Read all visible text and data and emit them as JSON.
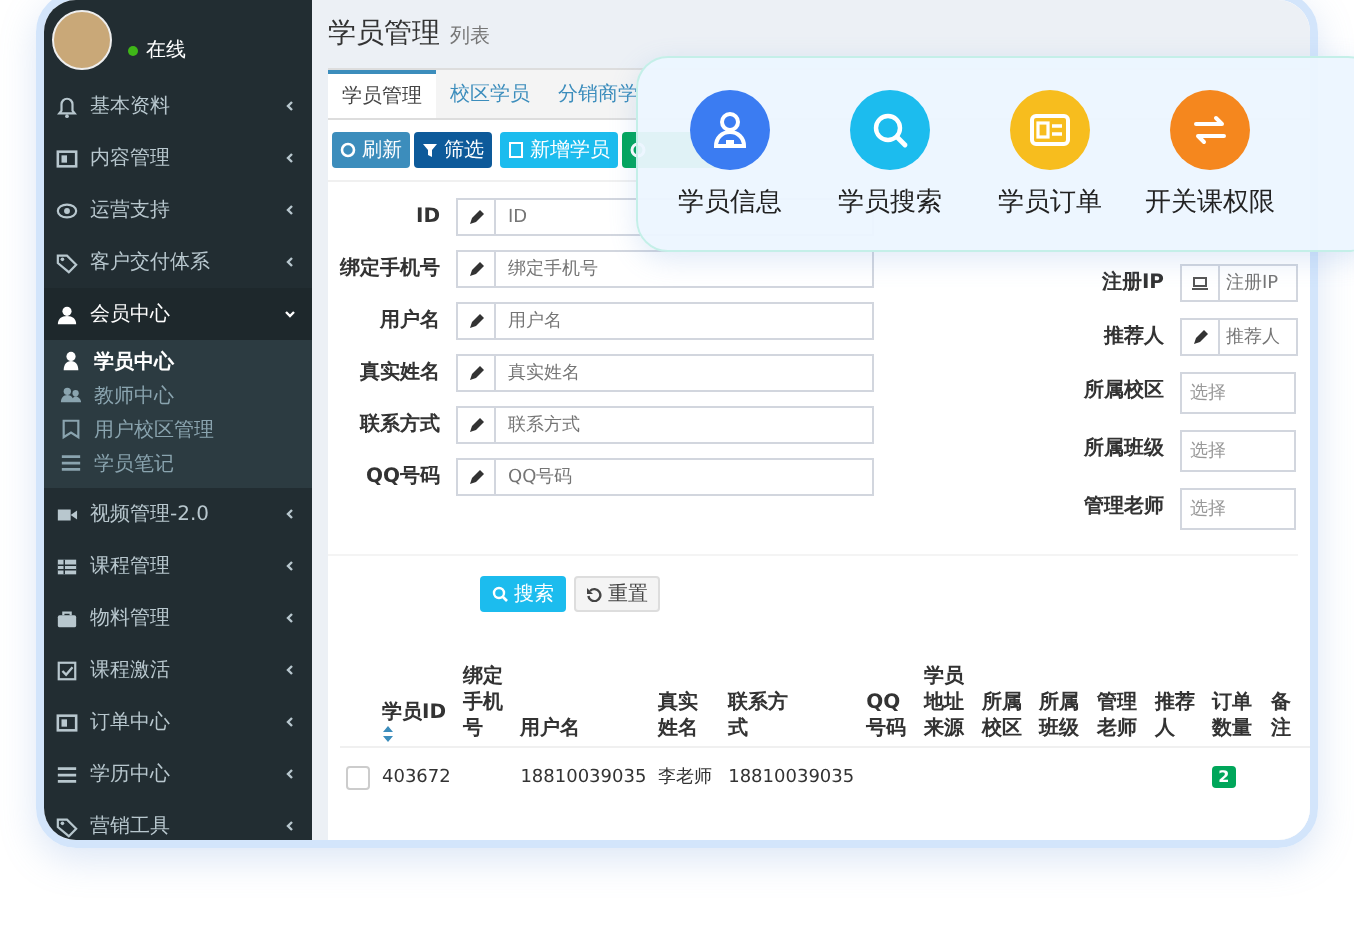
{
  "sidebar": {
    "user": {
      "status": "在线"
    },
    "items": [
      {
        "label": "基本资料",
        "expanded": false
      },
      {
        "label": "内容管理",
        "expanded": false
      },
      {
        "label": "运营支持",
        "expanded": false
      },
      {
        "label": "客户交付体系",
        "expanded": false
      },
      {
        "label": "会员中心",
        "expanded": true,
        "children": [
          {
            "label": "学员中心",
            "selected": true
          },
          {
            "label": "教师中心",
            "selected": false
          },
          {
            "label": "用户校区管理",
            "selected": false
          },
          {
            "label": "学员笔记",
            "selected": false
          }
        ]
      },
      {
        "label": "视频管理-2.0",
        "expanded": false
      },
      {
        "label": "课程管理",
        "expanded": false
      },
      {
        "label": "物料管理",
        "expanded": false
      },
      {
        "label": "课程激活",
        "expanded": false
      },
      {
        "label": "订单中心",
        "expanded": false
      },
      {
        "label": "学历中心",
        "expanded": false
      },
      {
        "label": "营销工具",
        "expanded": false
      }
    ]
  },
  "page": {
    "title": "学员管理",
    "subtitle": "列表"
  },
  "tabs": [
    {
      "label": "学员管理",
      "selected": true
    },
    {
      "label": "校区学员",
      "selected": false
    },
    {
      "label": "分销商学",
      "selected": false
    }
  ],
  "toolbar": [
    {
      "label": "刷新",
      "kind": "refresh"
    },
    {
      "label": "筛选",
      "kind": "filter"
    },
    {
      "label": "新增学员",
      "kind": "add"
    },
    {
      "kind": "export"
    }
  ],
  "form_left": [
    {
      "label": "ID",
      "placeholder": "ID",
      "kind": "text"
    },
    {
      "label": "绑定手机号",
      "placeholder": "绑定手机号",
      "kind": "text"
    },
    {
      "label": "用户名",
      "placeholder": "用户名",
      "kind": "text"
    },
    {
      "label": "真实姓名",
      "placeholder": "真实姓名",
      "kind": "text"
    },
    {
      "label": "联系方式",
      "placeholder": "联系方式",
      "kind": "text"
    },
    {
      "label": "QQ号码",
      "placeholder": "QQ号码",
      "kind": "text"
    }
  ],
  "form_right": [
    {
      "label": "注册IP",
      "placeholder": "注册IP",
      "kind": "ip"
    },
    {
      "label": "推荐人",
      "placeholder": "推荐人",
      "kind": "text"
    },
    {
      "label": "所属校区",
      "placeholder": "选择",
      "kind": "select"
    },
    {
      "label": "所属班级",
      "placeholder": "选择",
      "kind": "select"
    },
    {
      "label": "管理老师",
      "placeholder": "选择",
      "kind": "select"
    }
  ],
  "form_buttons": [
    {
      "label": "搜索",
      "kind": "search"
    },
    {
      "label": "重置",
      "kind": "reset"
    }
  ],
  "table": {
    "columns": [
      "学员ID",
      "绑定手机号",
      "用户名",
      "真实姓名",
      "联系方式",
      "QQ号码",
      "学员地址来源",
      "所属校区",
      "所属班级",
      "管理老师",
      "推荐人",
      "订单数量",
      "备注"
    ],
    "rows": [
      {
        "checked": false,
        "student_id": "403672",
        "username": "18810039035",
        "real_name": "李老师",
        "contact": "18810039035",
        "order_count": "2"
      }
    ]
  },
  "features": [
    {
      "label": "学员信息",
      "color": "#3b7cf2"
    },
    {
      "label": "学员搜索",
      "color": "#1cbcee"
    },
    {
      "label": "学员订单",
      "color": "#f7bd1e"
    },
    {
      "label": "开关课权限",
      "color": "#f5871e"
    }
  ]
}
